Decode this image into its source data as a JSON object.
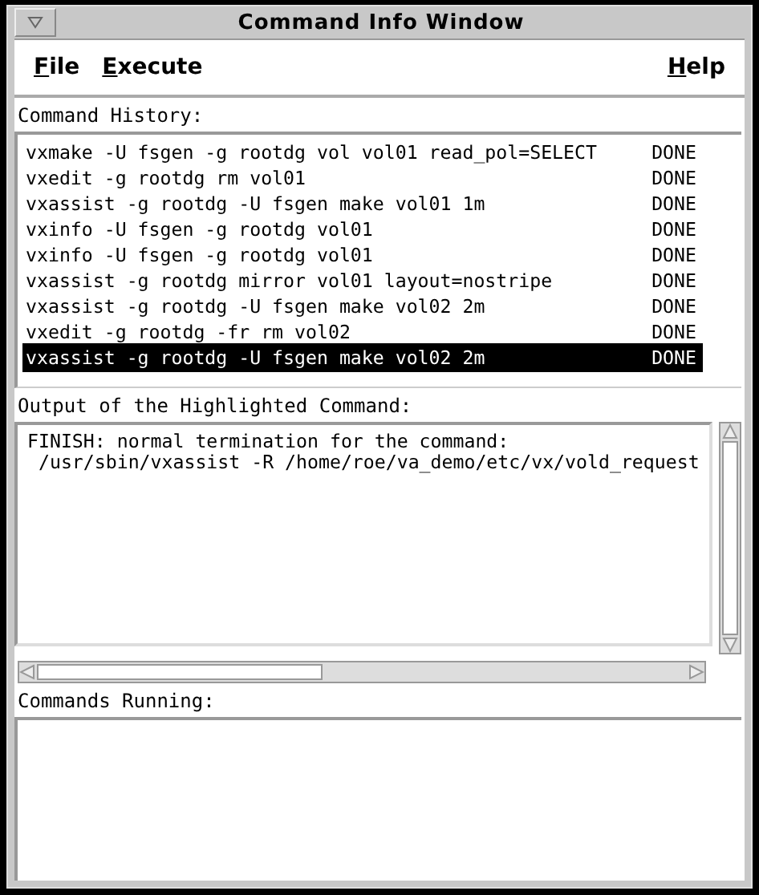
{
  "window": {
    "title": "Command Info Window"
  },
  "menu": [
    "File",
    "Execute",
    "Help"
  ],
  "history": {
    "label": "Command History:",
    "rows": [
      {
        "command": "vxmake -U fsgen -g rootdg vol vol01 read_pol=SELECT",
        "status": "DONE",
        "selected": false
      },
      {
        "command": "vxedit -g rootdg rm vol01",
        "status": "DONE",
        "selected": false
      },
      {
        "command": "vxassist -g rootdg -U fsgen make vol01 1m",
        "status": "DONE",
        "selected": false
      },
      {
        "command": "vxinfo -U fsgen -g rootdg vol01",
        "status": "DONE",
        "selected": false
      },
      {
        "command": "vxinfo -U fsgen -g rootdg vol01",
        "status": "DONE",
        "selected": false
      },
      {
        "command": "vxassist -g rootdg mirror vol01 layout=nostripe",
        "status": "DONE",
        "selected": false
      },
      {
        "command": "vxassist -g rootdg -U fsgen make vol02 2m",
        "status": "DONE",
        "selected": false
      },
      {
        "command": "vxedit -g rootdg -fr rm vol02",
        "status": "DONE",
        "selected": false
      },
      {
        "command": "vxassist -g rootdg -U fsgen make vol02 2m",
        "status": "DONE",
        "selected": true
      }
    ]
  },
  "output": {
    "label": "Output of the Highlighted Command:",
    "lines": [
      "FINISH: normal termination for the command:",
      " /usr/sbin/vxassist -R /home/roe/va_demo/etc/vx/vold_request"
    ]
  },
  "running": {
    "label": "Commands Running:"
  }
}
